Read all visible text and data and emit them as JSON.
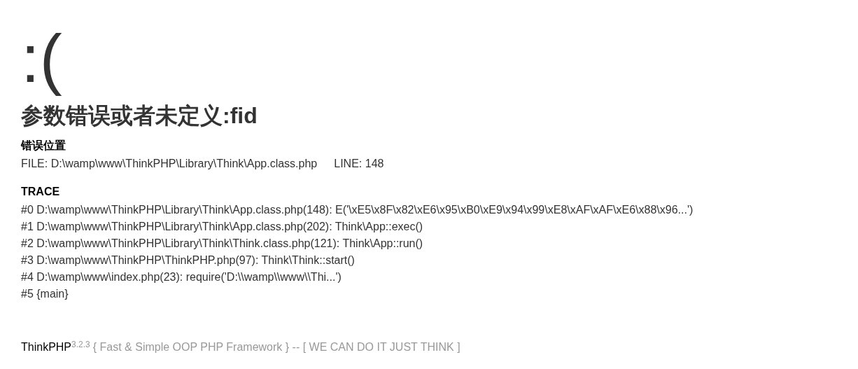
{
  "face": ":(",
  "message": "参数错误或者未定义:fid",
  "location": {
    "heading": "错误位置",
    "file": "FILE: D:\\wamp\\www\\ThinkPHP\\Library\\Think\\App.class.php",
    "line": "LINE: 148"
  },
  "trace": {
    "heading": "TRACE",
    "lines": [
      "#0 D:\\wamp\\www\\ThinkPHP\\Library\\Think\\App.class.php(148): E('\\xE5\\x8F\\x82\\xE6\\x95\\xB0\\xE9\\x94\\x99\\xE8\\xAF\\xAF\\xE6\\x88\\x96...')",
      "#1 D:\\wamp\\www\\ThinkPHP\\Library\\Think\\App.class.php(202): Think\\App::exec()",
      "#2 D:\\wamp\\www\\ThinkPHP\\Library\\Think\\Think.class.php(121): Think\\App::run()",
      "#3 D:\\wamp\\www\\ThinkPHP\\ThinkPHP.php(97): Think\\Think::start()",
      "#4 D:\\wamp\\www\\index.php(23): require('D:\\\\wamp\\\\www\\\\Thi...')",
      "#5 {main}"
    ]
  },
  "footer": {
    "brand": "ThinkPHP",
    "version": "3.2.3",
    "tagline": "{ Fast & Simple OOP PHP Framework } -- [ WE CAN DO IT JUST THINK ]"
  }
}
